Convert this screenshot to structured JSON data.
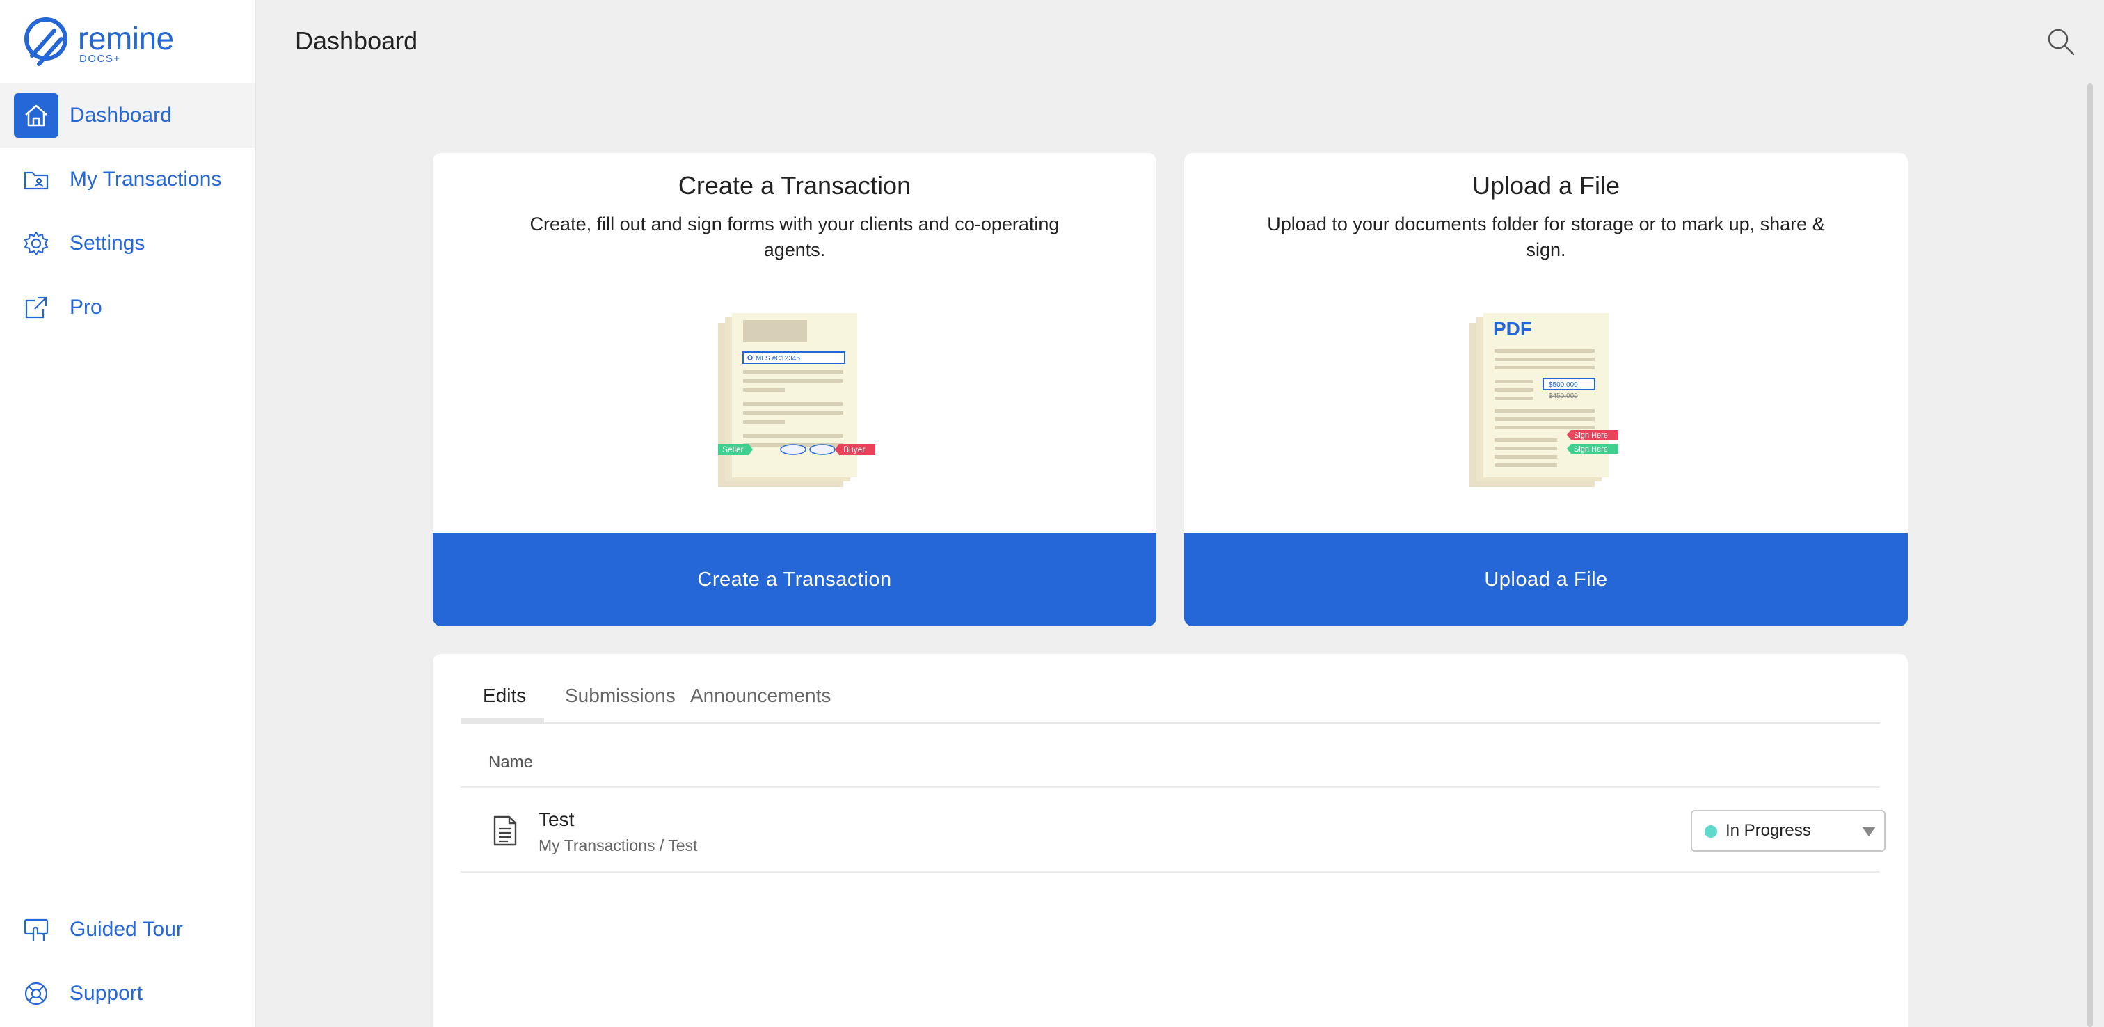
{
  "brand": {
    "name": "remine",
    "sub": "DOCS+",
    "color": "#2567d6"
  },
  "sidebar": {
    "items": [
      {
        "label": "Dashboard",
        "icon": "home-icon",
        "active": true
      },
      {
        "label": "My Transactions",
        "icon": "folder-icon",
        "active": false
      },
      {
        "label": "Settings",
        "icon": "gear-icon",
        "active": false
      },
      {
        "label": "Pro",
        "icon": "external-link-icon",
        "active": false
      }
    ],
    "bottom_items": [
      {
        "label": "Guided Tour",
        "icon": "guided-tour-icon"
      },
      {
        "label": "Support",
        "icon": "lifebuoy-icon"
      }
    ]
  },
  "header": {
    "title": "Dashboard",
    "search_icon": "search-icon"
  },
  "cards": [
    {
      "title": "Create a Transaction",
      "description": "Create, fill out and sign forms with your clients and co-operating agents.",
      "button": "Create a Transaction",
      "illustration": {
        "mls": "MLS #C12345",
        "tag_left": "Seller",
        "tag_right": "Buyer"
      }
    },
    {
      "title": "Upload a File",
      "description": "Upload to your documents folder for storage or to mark up, share & sign.",
      "button": "Upload a File",
      "illustration": {
        "badge": "PDF",
        "new_price": "$500,000",
        "old_price": "$450,000",
        "tag_1": "Sign Here",
        "tag_2": "Sign Here"
      }
    }
  ],
  "tabs": [
    {
      "label": "Edits",
      "active": true
    },
    {
      "label": "Submissions",
      "active": false
    },
    {
      "label": "Announcements",
      "active": false
    }
  ],
  "table": {
    "column": "Name",
    "rows": [
      {
        "name": "Test",
        "path": "My Transactions / Test",
        "status": "In Progress",
        "status_color": "#5fd9cc"
      }
    ]
  }
}
